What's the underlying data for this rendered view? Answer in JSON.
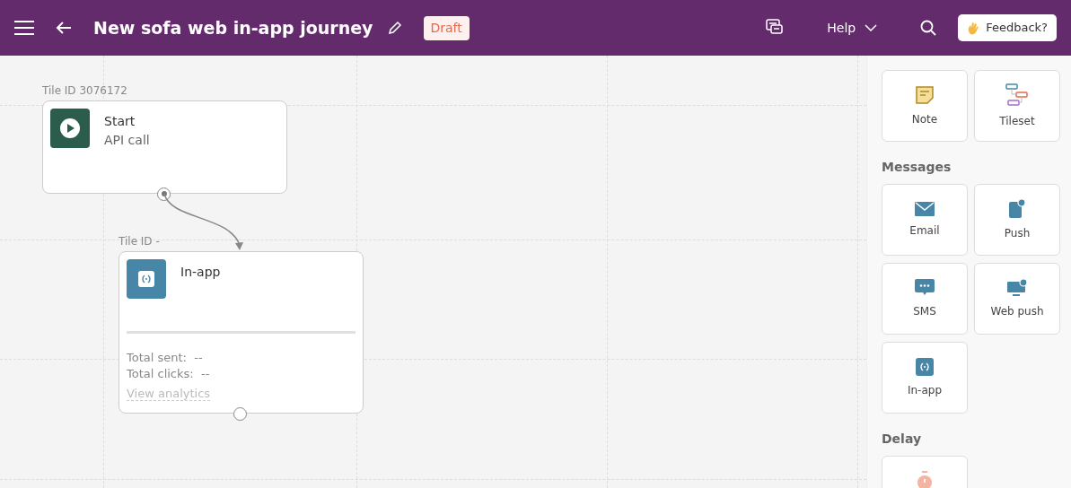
{
  "header": {
    "title": "New sofa web in-app journey",
    "status_badge": "Draft",
    "help_menu": "Help",
    "feedback_button": "Feedback?"
  },
  "canvas": {
    "nodes": [
      {
        "kind": "start",
        "tile_label": "Tile ID 3076172",
        "title": "Start",
        "subtitle": "API call"
      },
      {
        "kind": "in-app",
        "tile_label": "Tile ID -",
        "title": "In-app",
        "stats": [
          "Total sent:  --",
          "Total clicks:  --"
        ],
        "link": "View analytics"
      }
    ]
  },
  "sidebar": {
    "tiles": [
      {
        "kind": "note",
        "label": "Note"
      },
      {
        "kind": "tileset",
        "label": "Tileset"
      }
    ],
    "sections": [
      {
        "heading": "Messages",
        "tiles": [
          {
            "kind": "email",
            "label": "Email"
          },
          {
            "kind": "push",
            "label": "Push"
          },
          {
            "kind": "sms",
            "label": "SMS"
          },
          {
            "kind": "webpush",
            "label": "Web push"
          },
          {
            "kind": "inapp",
            "label": "In-app"
          }
        ]
      },
      {
        "heading": "Delay",
        "tiles": [
          {
            "kind": "delay"
          }
        ]
      }
    ]
  }
}
